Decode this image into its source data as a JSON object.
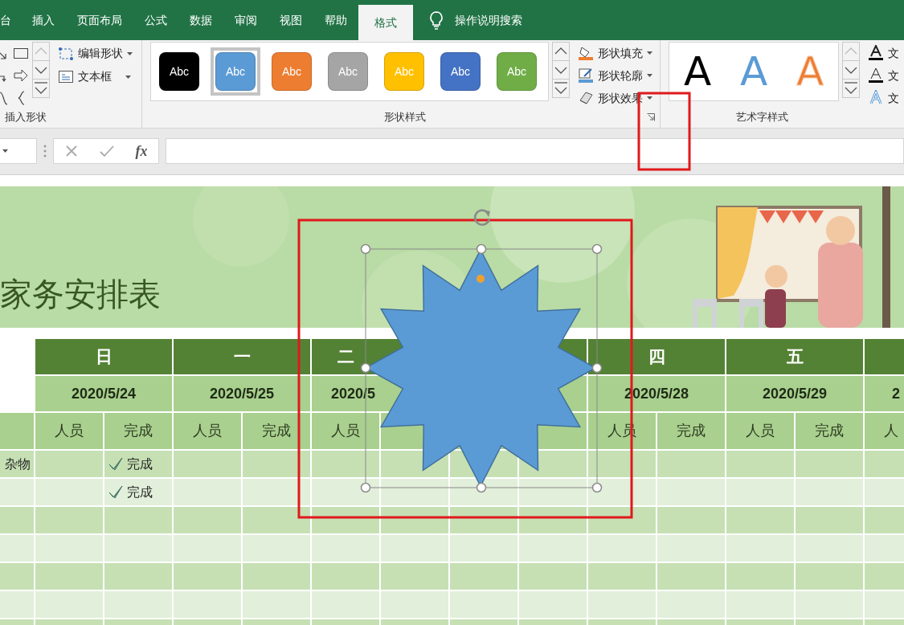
{
  "ribbon": {
    "tabs": [
      {
        "label": "台",
        "selected": false
      },
      {
        "label": "插入",
        "selected": false
      },
      {
        "label": "页面布局",
        "selected": false
      },
      {
        "label": "公式",
        "selected": false
      },
      {
        "label": "数据",
        "selected": false
      },
      {
        "label": "审阅",
        "selected": false
      },
      {
        "label": "视图",
        "selected": false
      },
      {
        "label": "帮助",
        "selected": false
      },
      {
        "label": "格式",
        "selected": true
      }
    ],
    "search": {
      "placeholder": "操作说明搜索"
    },
    "groups": [
      {
        "kind": "shapes",
        "label": "插入形状",
        "commands": [
          {
            "kind": "edit-shape",
            "label": "编辑形状",
            "dropdown": true
          },
          {
            "kind": "textbox",
            "label": "文本框",
            "dropdown": true
          }
        ]
      },
      {
        "kind": "styles",
        "label": "形状样式",
        "swatches": [
          {
            "text": "Abc",
            "color": "#000000",
            "selected": false
          },
          {
            "text": "Abc",
            "color": "#5b9bd5",
            "selected": true
          },
          {
            "text": "Abc",
            "color": "#ed7d31",
            "selected": false
          },
          {
            "text": "Abc",
            "color": "#a5a5a5",
            "selected": false
          },
          {
            "text": "Abc",
            "color": "#ffc000",
            "selected": false
          },
          {
            "text": "Abc",
            "color": "#4472c4",
            "selected": false
          },
          {
            "text": "Abc",
            "color": "#70ad47",
            "selected": false
          }
        ],
        "commands": [
          {
            "kind": "fill",
            "label": "形状填充",
            "dropdown": true
          },
          {
            "kind": "outline",
            "label": "形状轮廓",
            "dropdown": true
          },
          {
            "kind": "effect",
            "label": "形状效果",
            "dropdown": true
          }
        ]
      },
      {
        "kind": "wordart",
        "label": "艺术字样式",
        "swatches": [
          {
            "text": "A",
            "kind": "fill",
            "color": "#000000"
          },
          {
            "text": "A",
            "kind": "fill",
            "color": "#5b9bd5"
          },
          {
            "text": "A",
            "kind": "outline",
            "color": "#ed7d31"
          }
        ],
        "commands": [
          {
            "kind": "text-fill",
            "label": "文"
          },
          {
            "kind": "text-outline",
            "label": "文"
          },
          {
            "kind": "text-effect",
            "label": "文"
          }
        ]
      }
    ]
  },
  "formula_bar": {
    "function_label": "fx"
  },
  "sheet": {
    "title": "家务安排表",
    "columns": [
      {
        "kind": "day",
        "day": "日",
        "date": "2020/5/24",
        "sub": [
          "人员",
          "完成"
        ]
      },
      {
        "kind": "day",
        "day": "一",
        "date": "2020/5/25",
        "sub": [
          "人员",
          "完成"
        ]
      },
      {
        "kind": "day",
        "day": "二",
        "date": "2020/5",
        "sub": [
          "人员"
        ]
      },
      {
        "kind": "covered"
      },
      {
        "kind": "day",
        "day": "四",
        "date": "2020/5/28",
        "sub": [
          "人员",
          "完成"
        ]
      },
      {
        "kind": "day",
        "day": "五",
        "date": "2020/5/29",
        "sub": [
          "人员",
          "完成"
        ]
      },
      {
        "kind": "partial",
        "date": "2",
        "sub": [
          "人"
        ]
      }
    ],
    "rows": [
      {
        "label": "杂物",
        "entries": [
          {
            "status": "完成",
            "done": true
          }
        ]
      },
      {
        "entries": [
          {
            "status": "完成",
            "done": true
          }
        ]
      }
    ]
  }
}
